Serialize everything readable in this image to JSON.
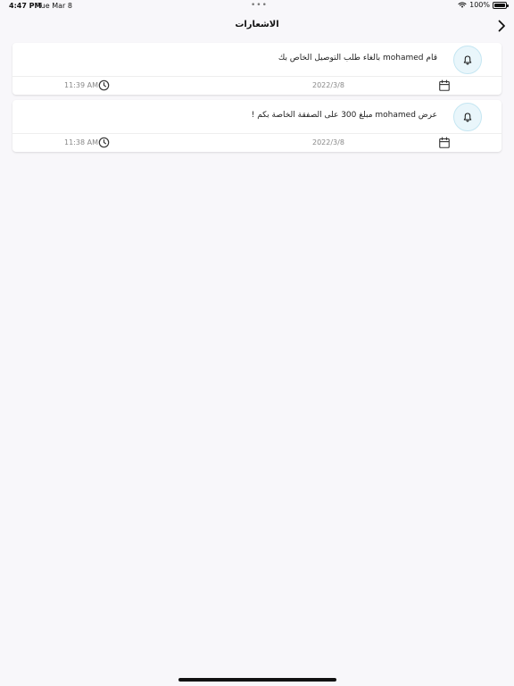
{
  "status_bar": {
    "time": "4:47 PM",
    "date": "Tue Mar 8",
    "dots": "•••",
    "battery_pct": "100%"
  },
  "nav": {
    "title": "الاشعارات",
    "back_icon": "chevron-right-icon"
  },
  "notifications": [
    {
      "message": "قام mohamed بالغاء طلب التوصيل الخاص بك",
      "date": "2022/3/8",
      "time": "11:39 AM",
      "icon": "bell-icon"
    },
    {
      "message": "عرض mohamed مبلغ 300 على الصفقة الخاصة بكم !",
      "date": "2022/3/8",
      "time": "11:38 AM",
      "icon": "bell-icon"
    }
  ],
  "colors": {
    "background": "#f8f7fa",
    "bell_bg": "#e9f6fb",
    "bell_border": "#c5e6f2"
  }
}
